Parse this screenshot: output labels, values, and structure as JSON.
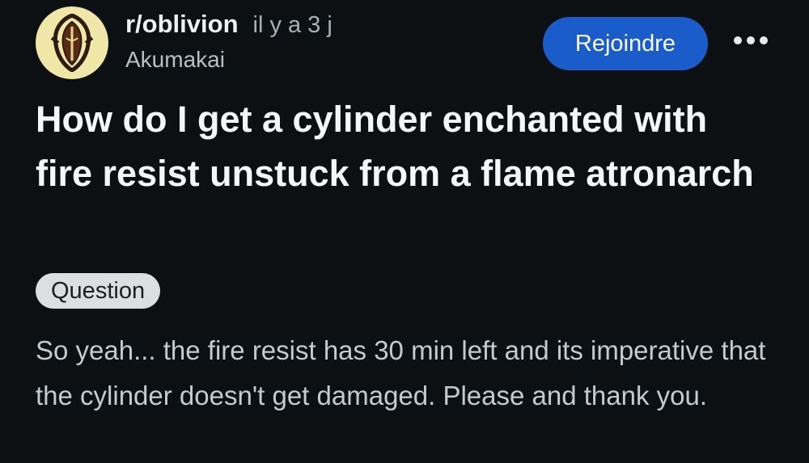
{
  "post": {
    "subreddit": "r/oblivion",
    "timestamp": "il y a 3 j",
    "author": "Akumakai",
    "join_label": "Rejoindre",
    "title": "How do I get a cylinder enchanted with fire resist unstuck from a flame atronarch",
    "flair": "Question",
    "body": "So yeah... the fire resist has 30 min left and its imperative that the cylinder doesn't get damaged. Please and thank you."
  },
  "icons": {
    "avatar": "oblivion-seal-icon",
    "more": "more-horizontal-icon"
  },
  "colors": {
    "background": "#0d1012",
    "join_button": "#1a5cc9",
    "avatar_bg": "#f0e6a8",
    "flair_bg": "#dcdfe2"
  }
}
